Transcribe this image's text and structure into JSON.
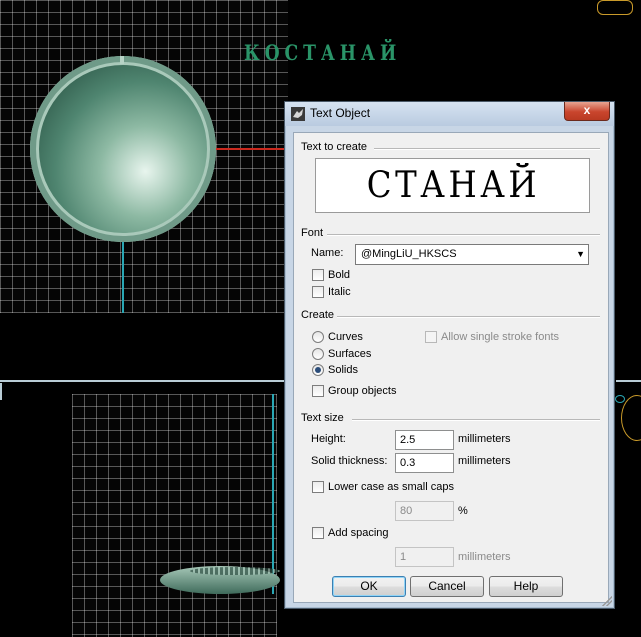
{
  "background": {
    "cyrillic_label": "КОСТАНАЙ",
    "corner_badge": "",
    "colors": {
      "grid_bg": "#050505",
      "x_axis": "#cc2a1f",
      "y_axis": "#2aa7b4",
      "model_green": "#4f8570"
    }
  },
  "dialog": {
    "title": "Text Object",
    "close_label": "x",
    "text_to_create": {
      "section_label": "Text to create",
      "preview_text": "СТАНАЙ"
    },
    "font": {
      "section_label": "Font",
      "name_label": "Name:",
      "name_value": "@MingLiU_HKSCS",
      "bold_label": "Bold",
      "bold_checked": false,
      "italic_label": "Italic",
      "italic_checked": false
    },
    "create": {
      "section_label": "Create",
      "curves_label": "Curves",
      "surfaces_label": "Surfaces",
      "solids_label": "Solids",
      "selected": "Solids",
      "single_stroke_label": "Allow single stroke fonts",
      "group_label": "Group objects"
    },
    "text_size": {
      "section_label": "Text size",
      "height_label": "Height:",
      "height_value": "2.5",
      "height_unit": "millimeters",
      "thickness_label": "Solid thickness:",
      "thickness_value": "0.3",
      "thickness_unit": "millimeters",
      "small_caps_label": "Lower case as small caps",
      "small_caps_value": "80",
      "small_caps_unit": "%",
      "spacing_label": "Add spacing",
      "spacing_value": "1",
      "spacing_unit": "millimeters"
    },
    "buttons": {
      "ok": "OK",
      "cancel": "Cancel",
      "help": "Help"
    }
  }
}
